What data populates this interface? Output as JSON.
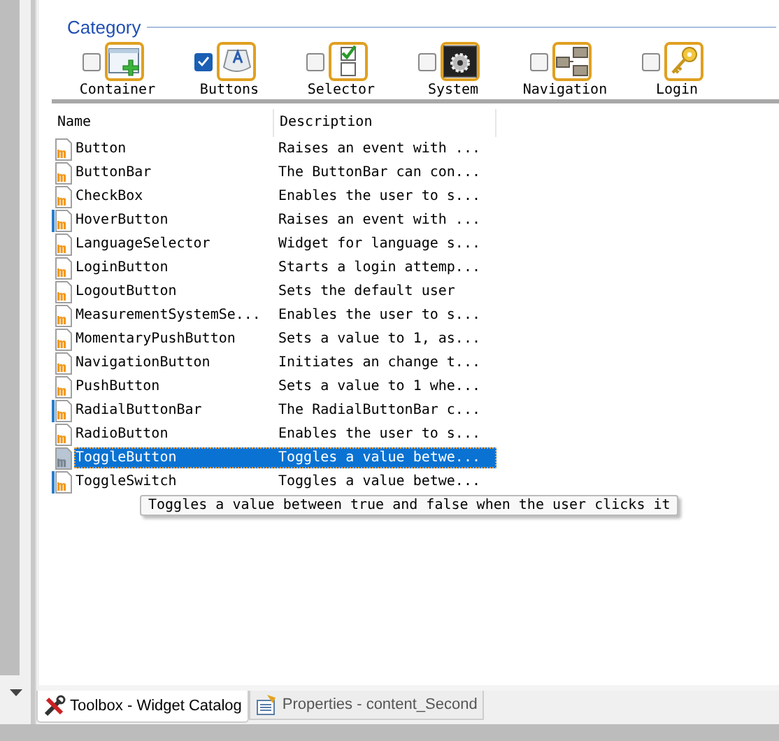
{
  "category": {
    "title": "Category",
    "items": [
      {
        "label": "Container",
        "checked": false,
        "kind": "container"
      },
      {
        "label": "Buttons",
        "checked": true,
        "kind": "buttons"
      },
      {
        "label": "Selector",
        "checked": false,
        "kind": "selector"
      },
      {
        "label": "System",
        "checked": false,
        "kind": "system"
      },
      {
        "label": "Navigation",
        "checked": false,
        "kind": "navigation"
      },
      {
        "label": "Login",
        "checked": false,
        "kind": "login"
      }
    ]
  },
  "table": {
    "columns": [
      "Name",
      "Description"
    ],
    "rows": [
      {
        "name": "Button",
        "description": "Raises an event with ...",
        "kind": "plain",
        "selected": false
      },
      {
        "name": "ButtonBar",
        "description": "The ButtonBar can con...",
        "kind": "plain",
        "selected": false
      },
      {
        "name": "CheckBox",
        "description": "Enables the user to s...",
        "kind": "plain",
        "selected": false
      },
      {
        "name": "HoverButton",
        "description": "Raises an event with ...",
        "kind": "marked",
        "selected": false
      },
      {
        "name": "LanguageSelector",
        "description": "Widget for language s...",
        "kind": "plain",
        "selected": false
      },
      {
        "name": "LoginButton",
        "description": "Starts a login attemp...",
        "kind": "plain",
        "selected": false
      },
      {
        "name": "LogoutButton",
        "description": "Sets the default user",
        "kind": "plain",
        "selected": false
      },
      {
        "name": "MeasurementSystemSe...",
        "description": "Enables the user to s...",
        "kind": "plain",
        "selected": false
      },
      {
        "name": "MomentaryPushButton",
        "description": "Sets a value to 1, as...",
        "kind": "plain",
        "selected": false
      },
      {
        "name": "NavigationButton",
        "description": "Initiates an change t...",
        "kind": "plain",
        "selected": false
      },
      {
        "name": "PushButton",
        "description": "Sets a value to 1 whe...",
        "kind": "plain",
        "selected": false
      },
      {
        "name": "RadialButtonBar",
        "description": "The RadialButtonBar c...",
        "kind": "marked",
        "selected": false
      },
      {
        "name": "RadioButton",
        "description": "Enables the user to s...",
        "kind": "plain",
        "selected": false
      },
      {
        "name": "ToggleButton",
        "description": "Toggles a value betwe...",
        "kind": "plain",
        "selected": true
      },
      {
        "name": "ToggleSwitch",
        "description": "Toggles a value betwe...",
        "kind": "marked",
        "selected": false
      }
    ]
  },
  "tooltip": "Toggles a value between true and false when the user clicks it",
  "tabs": [
    {
      "label": "Toolbox - Widget Catalog",
      "selected": true,
      "kind": "toolbox"
    },
    {
      "label": "Properties - content_Second",
      "selected": false,
      "kind": "properties"
    }
  ]
}
